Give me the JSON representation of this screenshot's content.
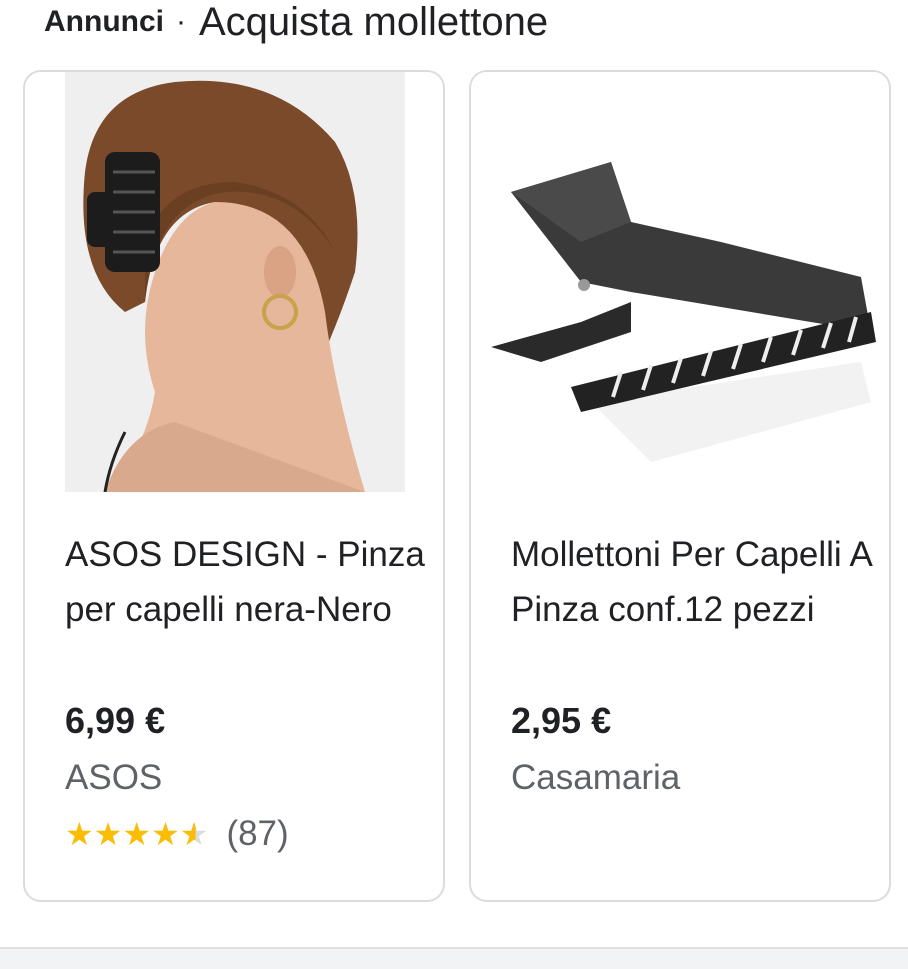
{
  "header": {
    "ads_label": "Annunci",
    "separator": "·",
    "title": "Acquista mollettone"
  },
  "products": [
    {
      "title": "ASOS DESIGN - Pinza per capelli nera-Nero",
      "price": "6,99 €",
      "merchant": "ASOS",
      "rating": 4.5,
      "reviews": "(87)",
      "image": "woman-with-black-hair-claw-clip"
    },
    {
      "title": "Mollettoni Per Capelli A Pinza conf.12 pezzi",
      "price": "2,95 €",
      "merchant": "Casamaria",
      "image": "black-plastic-hair-clip"
    }
  ],
  "colors": {
    "star": "#fbbc04",
    "border": "#dadce0",
    "secondary_text": "#5f6368"
  }
}
